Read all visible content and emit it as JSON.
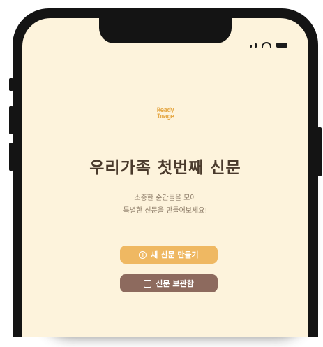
{
  "app": {
    "logo_line1": "Ready",
    "logo_line2": "Image"
  },
  "main": {
    "title": "우리가족 첫번째 신문",
    "subtitle_line1": "소중한 순간들을 모아",
    "subtitle_line2": "특별한 신문을 만들어보세요!"
  },
  "actions": {
    "new_newspaper_label": "새 신문 만들기",
    "new_newspaper_icon": "plus-circle-icon",
    "saved_label": "신문 보관함",
    "saved_icon": "save-icon"
  },
  "colors": {
    "background": "#fdf3dc",
    "primary_button": "#efb862",
    "secondary_button": "#8d6a5e",
    "title_text": "#4a3a2c",
    "logo": "#e6aa4a"
  }
}
